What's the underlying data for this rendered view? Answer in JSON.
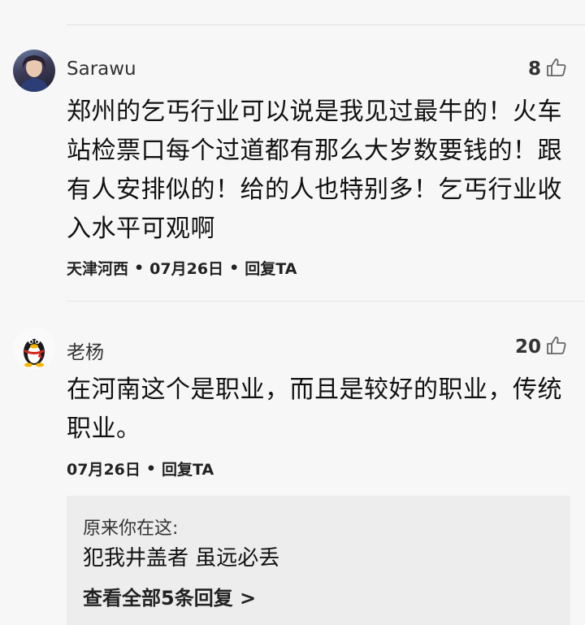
{
  "comments": [
    {
      "username": "Sarawu",
      "likes": "8",
      "text": "郑州的乞丐行业可以说是我见过最牛的！火车站检票口每个过道都有那么大岁数要钱的！跟有人安排似的！给的人也特别多！乞丐行业收入水平可观啊",
      "location": "天津河西",
      "date": "07月26日",
      "reply_label": "回复TA",
      "separator": "•",
      "avatar_icon": "user-photo-avatar"
    },
    {
      "username": "老杨",
      "likes": "20",
      "text": "在河南这个是职业，而且是较好的职业，传统职业。",
      "date": "07月26日",
      "reply_label": "回复TA",
      "separator": "•",
      "avatar_icon": "qq-penguin-avatar",
      "replies": {
        "author": "原来你在这:",
        "text": "犯我井盖者 虽远必丢",
        "view_all": "查看全部5条回复 >"
      }
    }
  ],
  "icons": {
    "like": "thumbs-up-icon"
  },
  "colors": {
    "background": "#f7f7f7",
    "reply_box": "#ededed",
    "text": "#111111"
  }
}
